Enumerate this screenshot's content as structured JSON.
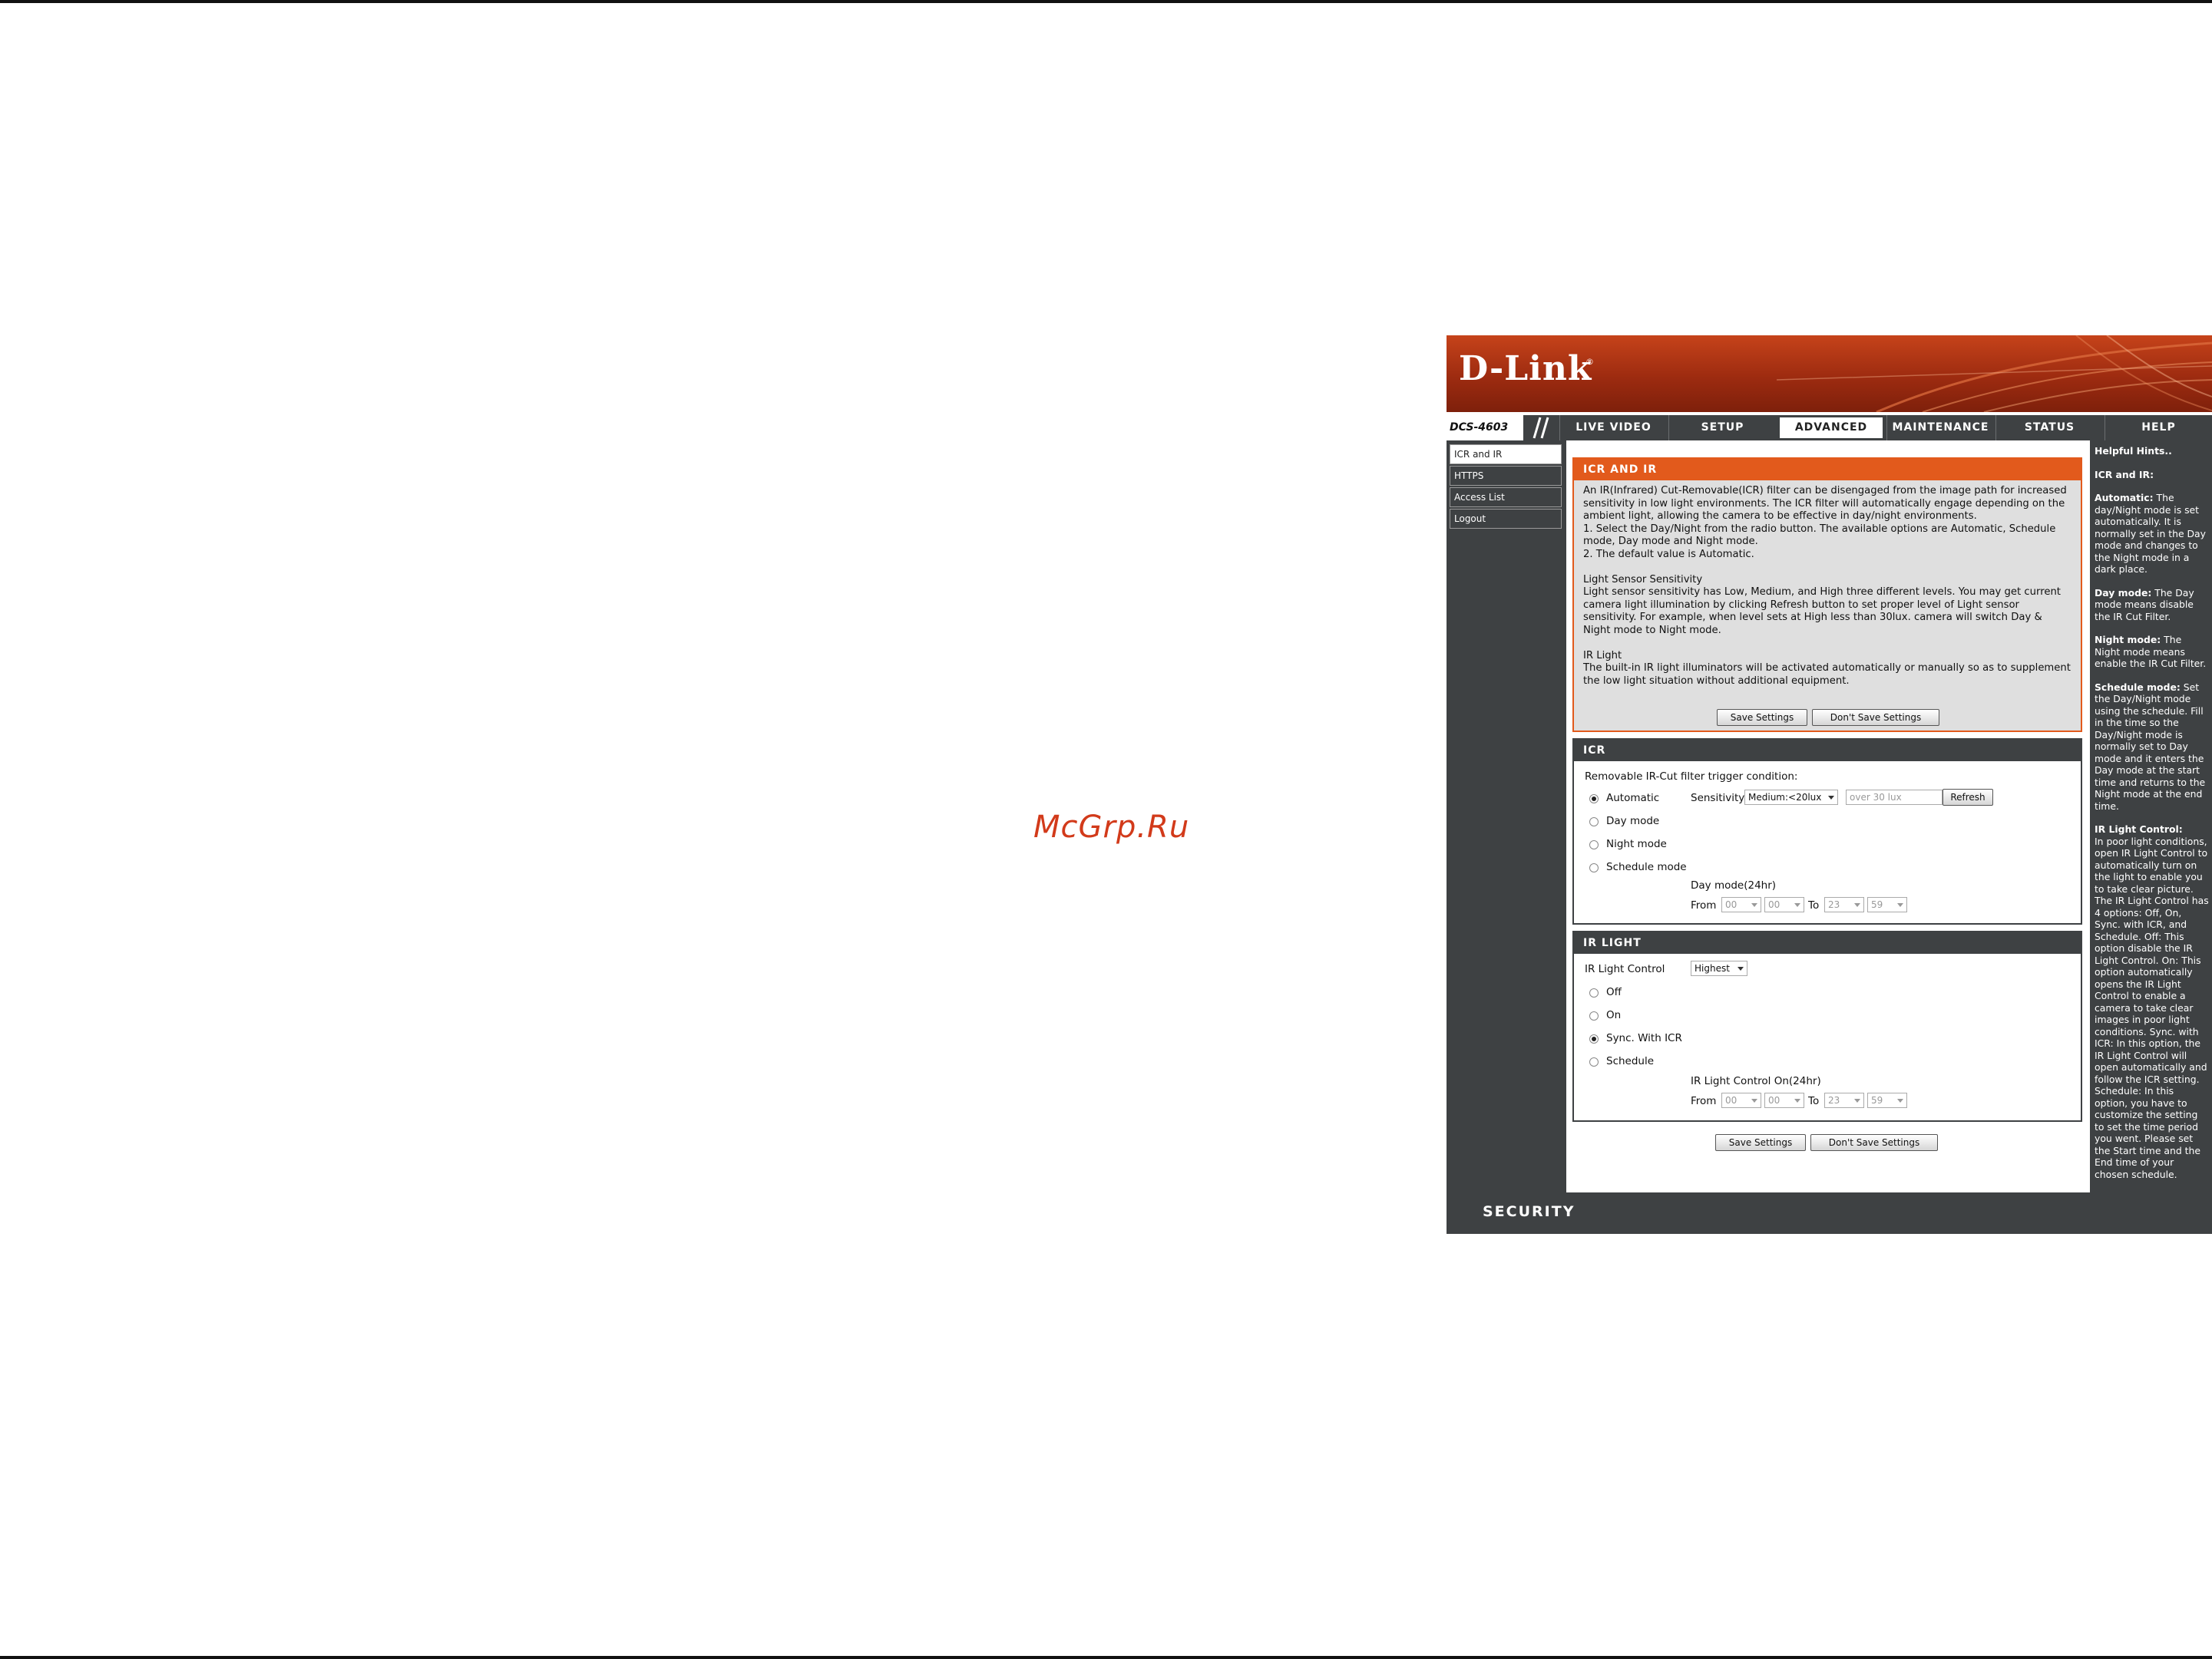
{
  "watermark": "McGrp.Ru",
  "brand": {
    "logo": "D-Link",
    "reg_mark": "®",
    "model": "DCS-4603"
  },
  "colors": {
    "accent": "#e25a1c",
    "dark": "#3e4143",
    "banner": "#b13a16"
  },
  "nav": {
    "tabs": [
      {
        "label": "LIVE VIDEO"
      },
      {
        "label": "SETUP"
      },
      {
        "label": "ADVANCED",
        "active": true
      },
      {
        "label": "MAINTENANCE"
      },
      {
        "label": "STATUS"
      },
      {
        "label": "HELP"
      }
    ]
  },
  "sidebar": {
    "items": [
      {
        "label": "ICR and IR",
        "active": true
      },
      {
        "label": "HTTPS"
      },
      {
        "label": "Access List"
      },
      {
        "label": "Logout"
      }
    ]
  },
  "intro": {
    "title": "ICR AND IR",
    "lines": [
      "An IR(Infrared) Cut-Removable(ICR) filter can be disengaged from the image path for increased sensitivity in low light environments. The ICR filter will automatically engage depending on the ambient light, allowing the camera to be effective in day/night environments.",
      "1. Select the Day/Night from the radio button. The available options are Automatic, Schedule mode, Day mode and Night mode.",
      "2. The default value is Automatic."
    ],
    "sensor_title": "Light Sensor Sensitivity",
    "sensor_text": "Light sensor sensitivity has Low, Medium, and High three different levels. You may get current camera light illumination by clicking Refresh button to set proper level of Light sensor sensitivity. For example, when level sets at High less than 30lux. camera will switch Day & Night mode to Night mode.",
    "ir_title": "IR Light",
    "ir_text": "The built-in IR light illuminators will be activated automatically or manually so as to supplement the low light situation without additional equipment.",
    "save_label": "Save Settings",
    "dont_save_label": "Don't Save Settings"
  },
  "icr": {
    "title": "ICR",
    "trigger_label": "Removable IR-Cut filter trigger condition:",
    "options": [
      "Automatic",
      "Day mode",
      "Night mode",
      "Schedule mode"
    ],
    "selected": "Automatic",
    "sensitivity_label": "Sensitivity",
    "sensitivity_value": "Medium:<20lux",
    "lux_value": "over 30 lux",
    "refresh_label": "Refresh",
    "schedule_label": "Day mode(24hr)",
    "from_label": "From",
    "to_label": "To",
    "from_hour": "00",
    "from_min": "00",
    "to_hour": "23",
    "to_min": "59"
  },
  "irlight": {
    "title": "IR LIGHT",
    "control_label": "IR Light Control",
    "control_value": "Highest",
    "options": [
      "Off",
      "On",
      "Sync. With ICR",
      "Schedule"
    ],
    "selected": "Sync. With ICR",
    "schedule_label": "IR Light Control On(24hr)",
    "from_label": "From",
    "to_label": "To",
    "from_hour": "00",
    "from_min": "00",
    "to_hour": "23",
    "to_min": "59"
  },
  "bottom_buttons": {
    "save_label": "Save Settings",
    "dont_save_label": "Don't Save Settings"
  },
  "hints": {
    "title": "Helpful Hints..",
    "icr_title": "ICR and IR:",
    "automatic_term": "Automatic:",
    "automatic_text": " The day/Night mode is set automatically. It is normally set in the Day mode and changes to the Night mode in a dark place.",
    "day_term": "Day mode:",
    "day_text": " The Day mode means disable the IR Cut Filter.",
    "night_term": "Night mode:",
    "night_text": " The Night mode means enable the IR Cut Filter.",
    "schedule_term": "Schedule mode:",
    "schedule_text": " Set the Day/Night mode using the schedule. Fill in the time so the Day/Night mode is normally set to Day mode and it enters the Day mode at the start time and returns to the Night mode at the end time.",
    "ir_term": "IR Light Control:",
    "ir_text": "In poor light conditions, open IR Light Control to automatically turn on the light to enable you to take clear picture. The IR Light Control has 4 options: Off, On, Sync. with ICR, and Schedule. Off: This option disable the IR Light Control. On: This option automatically opens the IR Light Control to enable a camera to take clear images in poor light conditions. Sync. with ICR: In this option, the IR Light Control will open automatically and follow the ICR setting. Schedule: In this option, you have to customize the setting to set the time period you went. Please set the Start time and the End time of your chosen schedule."
  },
  "footer": {
    "label": "SECURITY"
  }
}
